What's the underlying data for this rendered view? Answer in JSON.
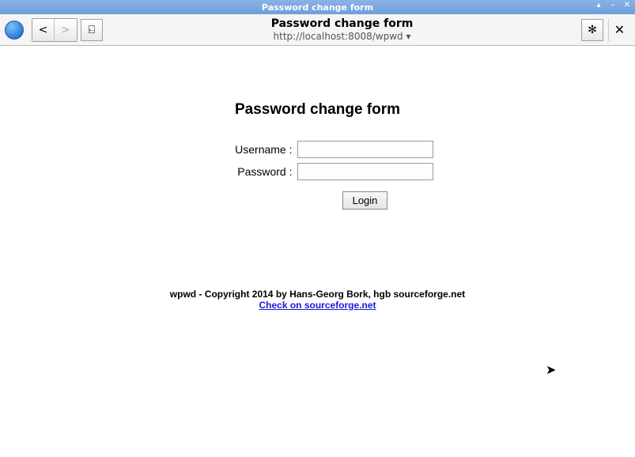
{
  "window": {
    "title": "Password change form",
    "controls": {
      "min": "▴",
      "restore": "–",
      "close": "✕"
    }
  },
  "toolbar": {
    "back": "<",
    "forward": ">",
    "bookmark": "⍇",
    "page_title": "Password change form",
    "url": "http://localhost:8008/wpwd ▾",
    "settings": "✻",
    "tab_close": "✕"
  },
  "page": {
    "heading": "Password change form",
    "username_label": "Username :",
    "password_label": "Password :",
    "username_value": "",
    "password_value": "",
    "login_label": "Login"
  },
  "footer": {
    "copyright": "wpwd - Copyright 2014 by Hans-Georg Bork, hgb sourceforge.net",
    "link_text": "Check on sourceforge.net"
  }
}
